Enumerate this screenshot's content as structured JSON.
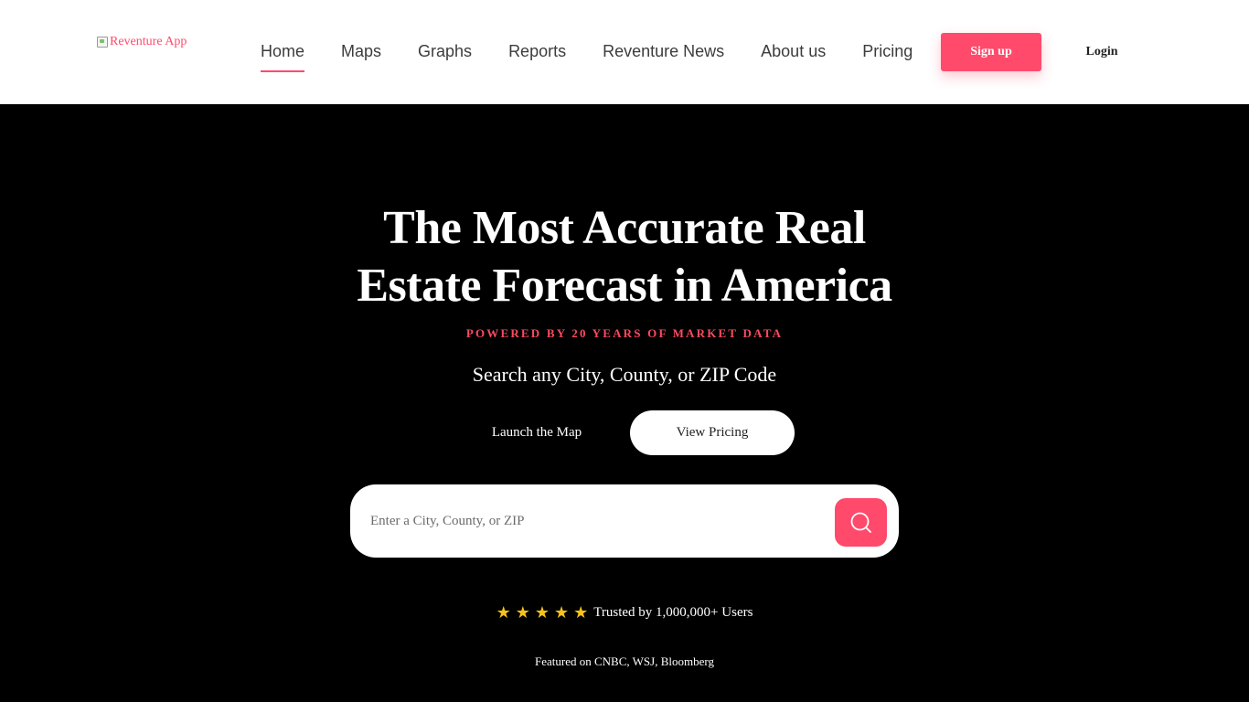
{
  "header": {
    "logo_alt": "Reventure App",
    "nav": [
      {
        "label": "Home",
        "active": true
      },
      {
        "label": "Maps"
      },
      {
        "label": "Graphs"
      },
      {
        "label": "Reports"
      },
      {
        "label": "Reventure News"
      },
      {
        "label": "About us"
      },
      {
        "label": "Pricing"
      }
    ],
    "signup_label": "Sign up",
    "login_label": "Login"
  },
  "hero": {
    "title_line1": "The Most Accurate Real",
    "title_line2": "Estate Forecast in America",
    "tagline": "POWERED BY 20 YEARS OF MARKET DATA",
    "subtitle": "Search any City, County, or ZIP Code",
    "launch_map_label": "Launch the Map",
    "view_pricing_label": "View Pricing",
    "search": {
      "placeholder": "Enter a City, County, or ZIP",
      "value": ""
    },
    "rating_stars": 5,
    "trust_text": "Trusted by 1,000,000+ Users",
    "featured_text": "Featured on CNBC, WSJ, Bloomberg"
  },
  "icons": {
    "broken_image": "broken-image-icon",
    "search": "search-icon",
    "star": "star-icon"
  },
  "colors": {
    "accent": "#ff4a6b",
    "tagline": "#ff4a5e",
    "star": "#f7c31a",
    "hero_bg": "#000000",
    "header_bg": "#ffffff"
  }
}
